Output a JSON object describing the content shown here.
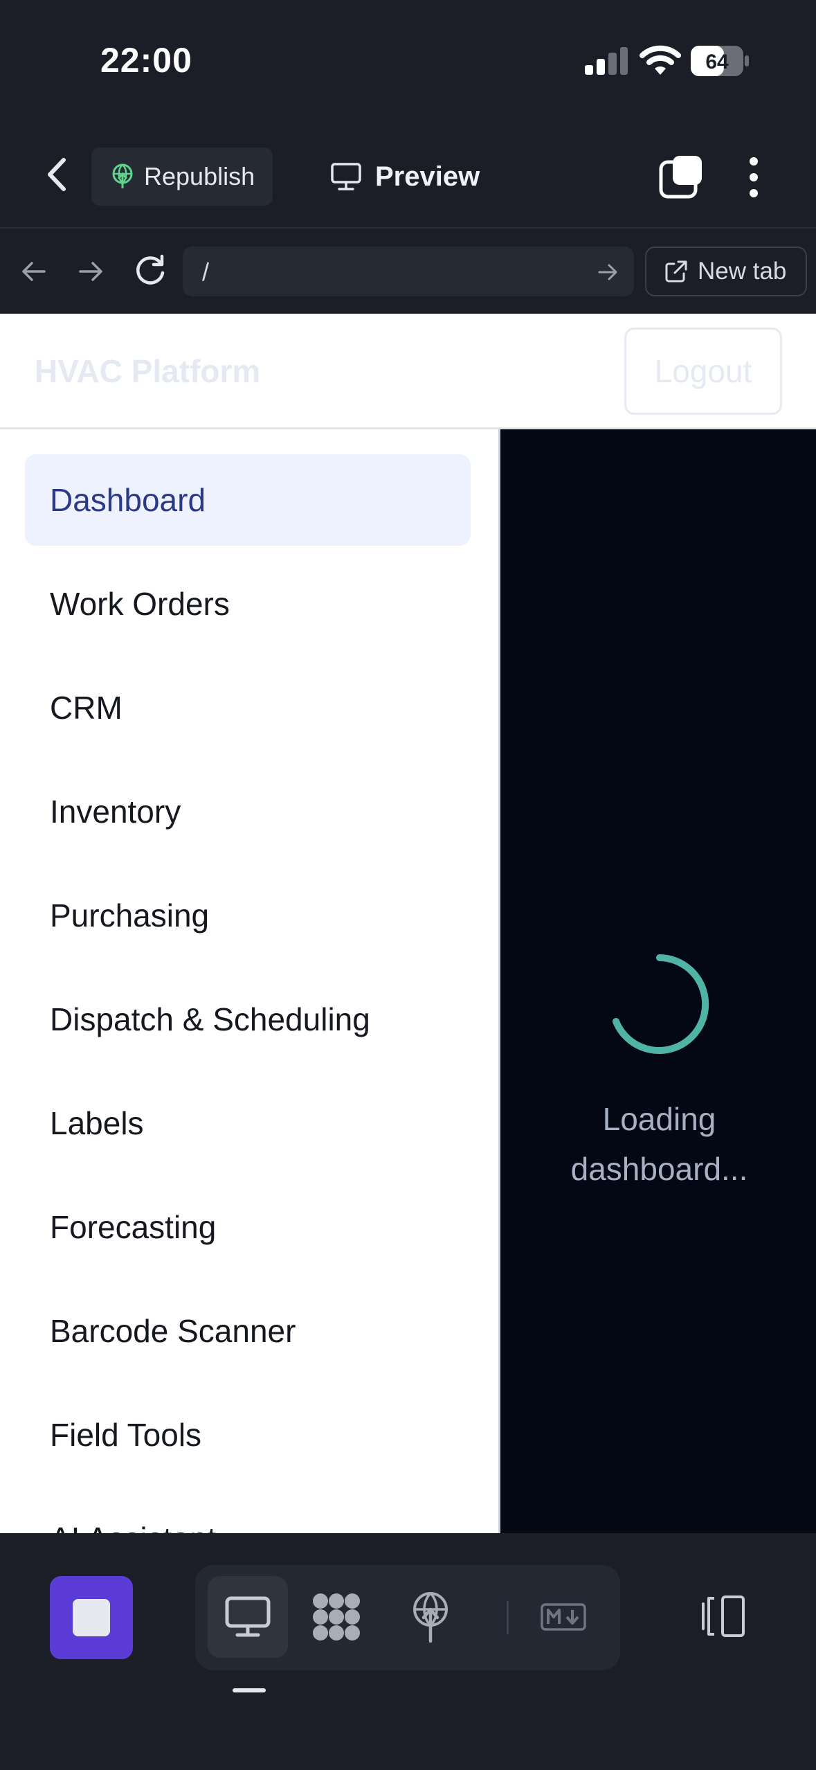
{
  "status_bar": {
    "time": "22:00",
    "battery": "64"
  },
  "toolbar": {
    "republish_label": "Republish",
    "preview_label": "Preview"
  },
  "address_bar": {
    "url": "/",
    "new_tab_label": "New tab"
  },
  "app": {
    "brand": "HVAC Platform",
    "logout_label": "Logout",
    "nav": [
      {
        "label": "Dashboard",
        "active": true
      },
      {
        "label": "Work Orders"
      },
      {
        "label": "CRM"
      },
      {
        "label": "Inventory"
      },
      {
        "label": "Purchasing"
      },
      {
        "label": "Dispatch & Scheduling"
      },
      {
        "label": "Labels"
      },
      {
        "label": "Forecasting"
      },
      {
        "label": "Barcode Scanner"
      },
      {
        "label": "Field Tools"
      },
      {
        "label": "AI Assistant"
      }
    ],
    "loading_line1": "Loading",
    "loading_line2": "dashboard..."
  },
  "colors": {
    "accent": "#5a3bd6",
    "spinner": "#4fb3a6",
    "active_nav_bg": "#eef1fe",
    "active_nav_text": "#2a3a86",
    "republish_icon": "#5fd38d"
  },
  "icons": [
    "signal-icon",
    "wifi-icon",
    "battery-icon",
    "back-chevron-icon",
    "globe-icon",
    "monitor-icon",
    "tabs-icon",
    "more-icon",
    "arrow-left-icon",
    "arrow-right-icon",
    "reload-icon",
    "external-link-icon",
    "stop-icon",
    "dots-icon",
    "markdown-icon",
    "panel-icon"
  ]
}
